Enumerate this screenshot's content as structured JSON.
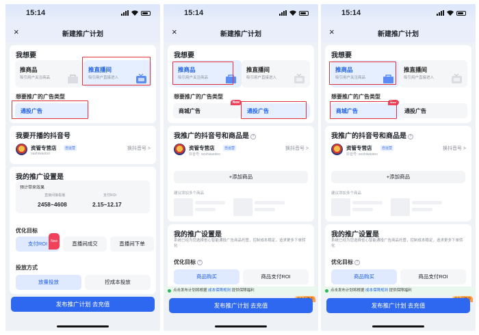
{
  "status": {
    "time": "15:14"
  },
  "nav": {
    "title": "新建推广计划",
    "close": "×"
  },
  "phone1": {
    "want_title": "我想要",
    "opt_product": {
      "title": "推商品",
      "desc": "吸引用户关注商品"
    },
    "opt_live": {
      "title": "推直播间",
      "desc": "吸引用户直接进入"
    },
    "adtype_title": "想要推广的广告类型",
    "adtype_selected": "通投广告",
    "account_title": "我要开播的抖音号",
    "account_name": "资管专营店",
    "account_tag": "自运营",
    "account_id": "oashiwaotoo",
    "switch_account": "换抖音号 >",
    "settings_title": "我的推广设置是",
    "estimate_label": "预计带来效果",
    "est_k1": "直接间接看播",
    "est_v1": "2458~4608",
    "est_k2": "支付ROI",
    "est_v2": "2.15~12.17",
    "goal_title": "优化目标",
    "goals": [
      "支付ROI",
      "直播间成交",
      "直播间下单"
    ],
    "goal_new": "New",
    "method_title": "投放方式",
    "methods": [
      "放量投放",
      "控成本投放"
    ],
    "publish": "发布推广计划 去充值"
  },
  "phone23": {
    "want_title": "我想要",
    "opt_product": {
      "title": "推商品",
      "desc": "吸引用户关注商品"
    },
    "opt_live": {
      "title": "推直播间",
      "desc": "吸引用户直接进入"
    },
    "adtype_title": "想要推广的广告类型",
    "ad_mall": "商城广告",
    "ad_general": "通投广告",
    "new_tag": "New",
    "account_title": "我推广的抖音号和商品是",
    "account_name": "资管专营店",
    "account_tag": "自运营",
    "account_id": "抖音号: ooshiwaoteo",
    "switch_account": "换抖音号 >",
    "add_product": "+添加商品",
    "hint": "建议添加多个商品",
    "settings_title": "我的推广设置是",
    "settings_desc": "系统已经为您选择省心智能通投广告商品托管，控制成本稳定，追求更多下单转化",
    "goal_title": "优化目标",
    "goals": [
      "商品购买",
      "商品支付ROI"
    ],
    "bar_text_a": "点击发布计划将根据",
    "bar_link": "成本保障规则",
    "bar_text_b": "提供保障福利",
    "guarantee": "成本保障中",
    "publish": "发布推广计划 去充值"
  }
}
